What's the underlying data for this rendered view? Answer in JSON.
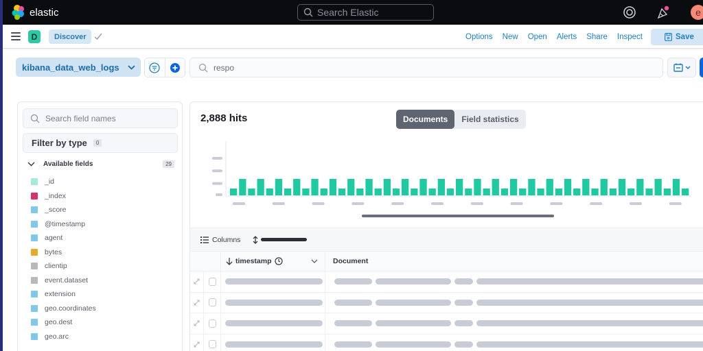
{
  "header": {
    "logo_text": "elastic",
    "search_placeholder": "Search Elastic",
    "avatar_initial": "e",
    "icons": [
      "elastic-logo-icon",
      "search-icon",
      "help-icon",
      "newsfeed-icon"
    ]
  },
  "app_bar": {
    "space_initial": "D",
    "breadcrumb": "Discover",
    "links": [
      "Options",
      "New",
      "Open",
      "Alerts",
      "Share",
      "Inspect"
    ],
    "save_label": "Save"
  },
  "query_bar": {
    "data_view": "kibana_data_web_logs",
    "query_value": "respo"
  },
  "sidebar": {
    "search_placeholder": "Search field names",
    "filter_label": "Filter by type",
    "filter_count": "0",
    "available_label": "Available fields",
    "available_count": "29",
    "fields": [
      {
        "name": "_id",
        "color": "#a6ead8"
      },
      {
        "name": "_index",
        "color": "#d6316f"
      },
      {
        "name": "_score",
        "color": "#7fc8ea"
      },
      {
        "name": "@timestamp",
        "color": "#7fc8ea"
      },
      {
        "name": "agent",
        "color": "#7fc8ea"
      },
      {
        "name": "bytes",
        "color": "#e9aa2c"
      },
      {
        "name": "clientip",
        "color": "#b9b9b9"
      },
      {
        "name": "event.dataset",
        "color": "#b9b9b9"
      },
      {
        "name": "extension",
        "color": "#7fc8ea"
      },
      {
        "name": "geo.coordinates",
        "color": "#7fc8ea"
      },
      {
        "name": "geo.dest",
        "color": "#7fc8ea"
      },
      {
        "name": "geo.arc",
        "color": "#7fc8ea"
      }
    ]
  },
  "main": {
    "hits": "2,888 hits",
    "tabs": [
      {
        "label": "Documents",
        "active": true
      },
      {
        "label": "Field statistics",
        "active": false
      }
    ],
    "columns_label": "Columns",
    "grid_headers": [
      "timestamp",
      "Document"
    ],
    "row_count": 4
  },
  "colors": {
    "bar": "#20c9a1",
    "accent": "#1f7fc0"
  },
  "chart_data": {
    "type": "bar",
    "title": "",
    "xlabel": "",
    "ylabel": "",
    "note": "Histogram of hits over time; axis tick labels are rendered as gray placeholders (unreadable).",
    "ylim": [
      0,
      4
    ],
    "values": [
      1,
      2,
      1,
      2,
      1,
      2,
      1,
      2,
      1,
      2,
      1,
      2,
      1,
      2,
      1,
      2,
      1,
      2,
      1,
      2,
      1,
      2,
      1,
      2,
      1,
      2,
      1,
      2,
      1,
      2,
      1,
      2,
      1,
      2,
      1,
      2,
      1,
      2,
      1,
      2,
      1,
      2,
      1,
      2,
      1,
      2,
      1,
      2,
      1,
      2,
      1
    ],
    "y_ticks": 4,
    "x_ticks": 12
  }
}
